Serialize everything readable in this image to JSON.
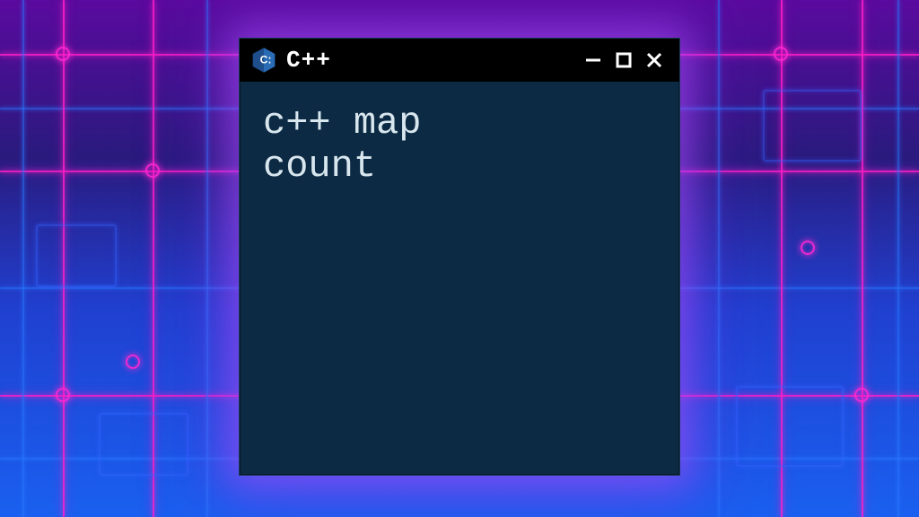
{
  "window": {
    "title": "C++",
    "icon_name": "cpp-logo-icon"
  },
  "editor": {
    "content_line1": "c++ map",
    "content_line2": "count"
  },
  "controls": {
    "minimize_name": "minimize-icon",
    "maximize_name": "maximize-icon",
    "close_name": "close-icon"
  }
}
